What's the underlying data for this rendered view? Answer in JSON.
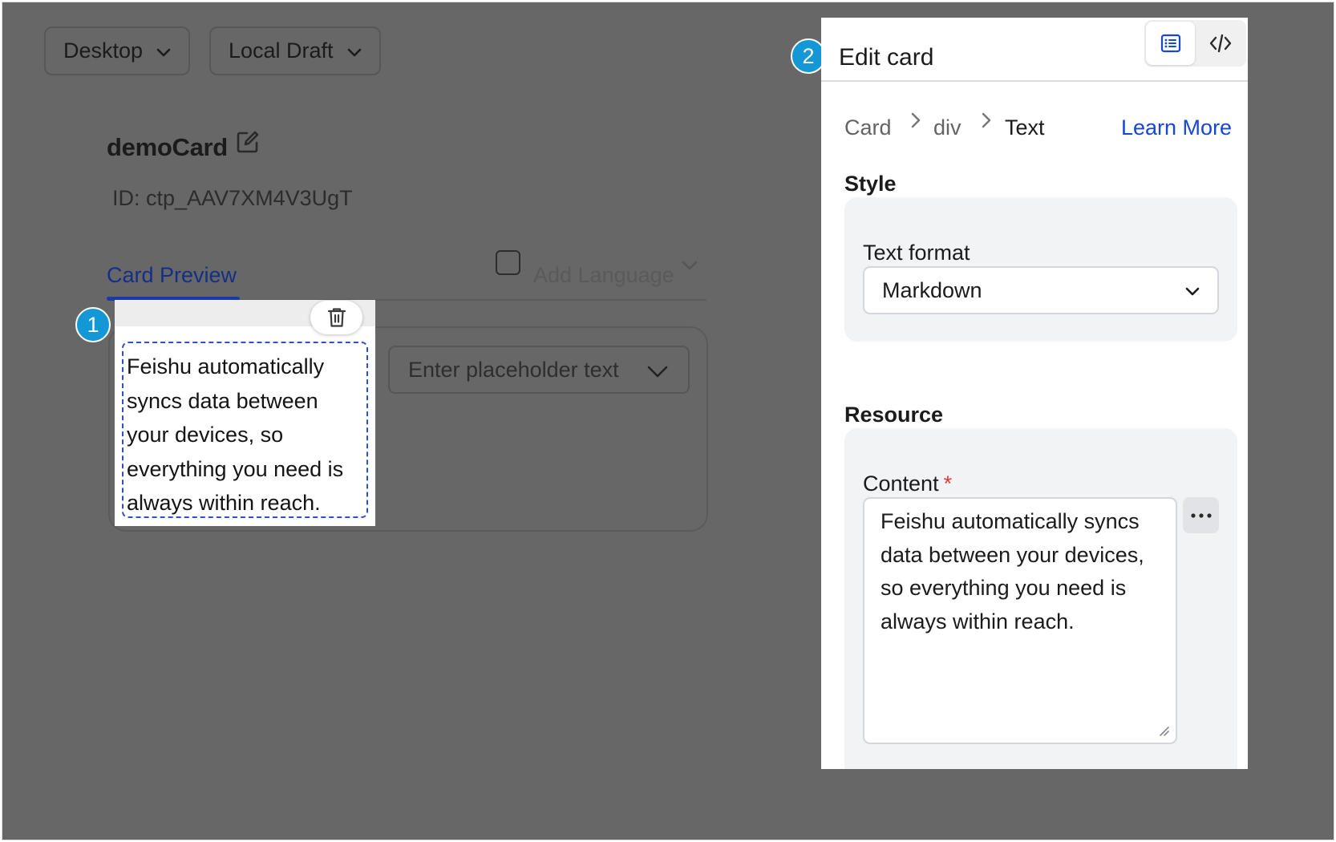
{
  "toolbar": {
    "device_label": "Desktop",
    "draft_label": "Local Draft"
  },
  "card": {
    "name": "demoCard",
    "id_text": "ID: ctp_AAV7XM4V3UgT"
  },
  "preview": {
    "tab_label": "Card Preview",
    "add_language_label": "Add Language",
    "selected_text": "Feishu automatically syncs data between your devices, so everything you need is always within reach.",
    "select_placeholder": "Enter placeholder text"
  },
  "markers": {
    "one": "1",
    "two": "2"
  },
  "panel": {
    "title": "Edit card",
    "breadcrumb": [
      "Card",
      "div",
      "Text"
    ],
    "learn_more": "Learn More",
    "style_section": "Style",
    "text_format_label": "Text format",
    "text_format_value": "Markdown",
    "resource_section": "Resource",
    "content_label": "Content",
    "required_mark": "*",
    "content_value": "Feishu automatically syncs data between your devices, so everything you need is always within reach."
  },
  "colors": {
    "overlay": "#676767",
    "accent_blue": "#1847d6",
    "marker_blue": "#1497d5",
    "required_red": "#e03a3a",
    "selection_dash": "#2f4fd0"
  },
  "icons": {
    "device_dropdown": "chevron-down-icon",
    "edit": "edit-icon",
    "delete": "trash-icon",
    "form_view": "list-form-icon",
    "code_view": "code-icon",
    "breadcrumb_sep": "chevron-right-icon",
    "more": "more-icon"
  }
}
